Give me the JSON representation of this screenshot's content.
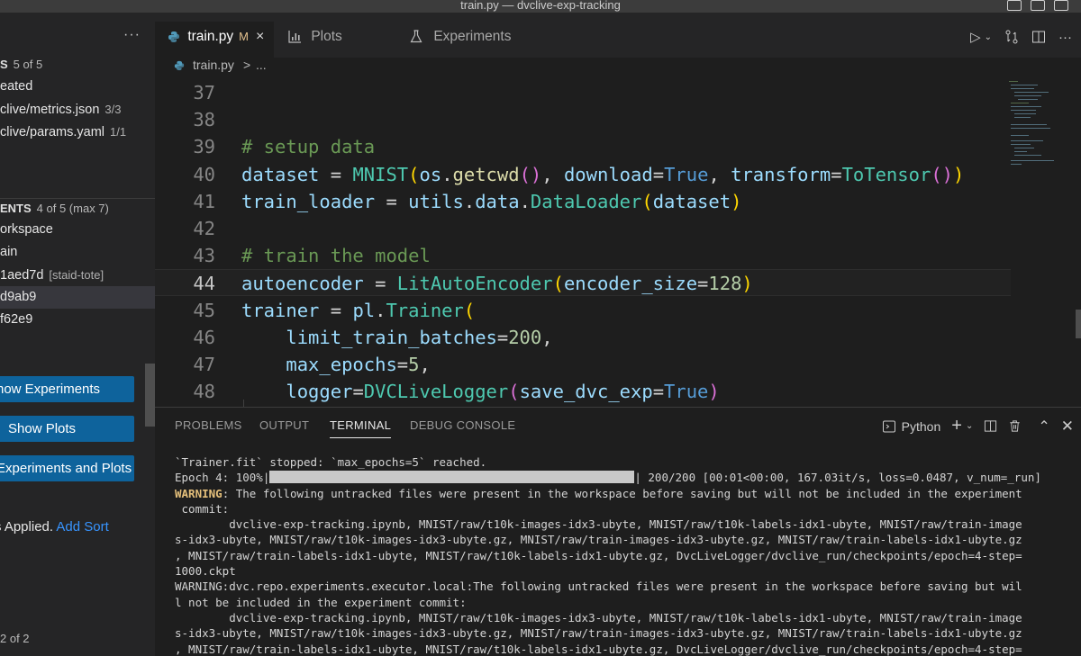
{
  "window": {
    "title": "train.py — dvclive-exp-tracking"
  },
  "sidebar": {
    "more": "···",
    "changes": {
      "header": "S",
      "count": "5 of 5",
      "items": [
        {
          "label": "eated",
          "meta": ""
        },
        {
          "label": "clive/metrics.json",
          "meta": "3/3"
        },
        {
          "label": "clive/params.yaml",
          "meta": "1/1"
        }
      ]
    },
    "experiments": {
      "header": "ENTS",
      "count": "4 of 5 (max 7)",
      "items": [
        {
          "label": "orkspace",
          "meta": ""
        },
        {
          "label": "ain",
          "meta": ""
        },
        {
          "label": "1aed7d",
          "meta": "[staid-tote]"
        },
        {
          "label": "d9ab9",
          "meta": ""
        },
        {
          "label": "f62e9",
          "meta": ""
        }
      ]
    },
    "buttons": {
      "show_experiments": "how Experiments",
      "show_plots": "Show Plots",
      "experiments_and_plots": "Experiments and Plots"
    },
    "sort": {
      "text": "s Applied.",
      "link": "Add Sort"
    },
    "pager": "2 of 2"
  },
  "tabs": [
    {
      "label": "train.py",
      "modified": "M",
      "close": "×"
    },
    {
      "label": "Plots"
    },
    {
      "label": "Experiments"
    }
  ],
  "breadcrumbs": {
    "file": "train.py",
    "sep": ">",
    "rest": "..."
  },
  "editor": {
    "lines": [
      {
        "n": "37",
        "code": [],
        "current": false
      },
      {
        "n": "38",
        "code": [],
        "current": false
      },
      {
        "n": "39",
        "code": [
          [
            "k-com",
            "# setup data"
          ]
        ],
        "current": false
      },
      {
        "n": "40",
        "code": [
          [
            "k-var",
            "dataset"
          ],
          [
            "k-op",
            " = "
          ],
          [
            "k-cls",
            "MNIST"
          ],
          [
            "k-br1",
            "("
          ],
          [
            "k-var",
            "os"
          ],
          [
            "k-op",
            "."
          ],
          [
            "k-fn",
            "getcwd"
          ],
          [
            "k-br2",
            "()"
          ],
          [
            "k-op",
            ", "
          ],
          [
            "k-var",
            "download"
          ],
          [
            "k-op",
            "="
          ],
          [
            "k-kw",
            "True"
          ],
          [
            "k-op",
            ", "
          ],
          [
            "k-var",
            "transform"
          ],
          [
            "k-op",
            "="
          ],
          [
            "k-cls",
            "ToTensor"
          ],
          [
            "k-br2",
            "()"
          ],
          [
            "k-br1",
            ")"
          ]
        ],
        "current": false
      },
      {
        "n": "41",
        "code": [
          [
            "k-var",
            "train_loader"
          ],
          [
            "k-op",
            " = "
          ],
          [
            "k-var",
            "utils"
          ],
          [
            "k-op",
            "."
          ],
          [
            "k-var",
            "data"
          ],
          [
            "k-op",
            "."
          ],
          [
            "k-cls",
            "DataLoader"
          ],
          [
            "k-br1",
            "("
          ],
          [
            "k-var",
            "dataset"
          ],
          [
            "k-br1",
            ")"
          ]
        ],
        "current": false
      },
      {
        "n": "42",
        "code": [],
        "current": false
      },
      {
        "n": "43",
        "code": [
          [
            "k-com",
            "# train the model"
          ]
        ],
        "current": false
      },
      {
        "n": "44",
        "code": [
          [
            "k-var",
            "autoencoder"
          ],
          [
            "k-op",
            " = "
          ],
          [
            "k-cls",
            "LitAutoEncoder"
          ],
          [
            "k-br1",
            "("
          ],
          [
            "k-var",
            "encoder_size"
          ],
          [
            "k-op",
            "="
          ],
          [
            "k-num",
            "128"
          ],
          [
            "k-br1",
            ")"
          ]
        ],
        "current": true
      },
      {
        "n": "45",
        "code": [
          [
            "k-var",
            "trainer"
          ],
          [
            "k-op",
            " = "
          ],
          [
            "k-var",
            "pl"
          ],
          [
            "k-op",
            "."
          ],
          [
            "k-cls",
            "Trainer"
          ],
          [
            "k-br1",
            "("
          ]
        ],
        "current": false
      },
      {
        "n": "46",
        "code": [
          [
            "k-op",
            "    "
          ],
          [
            "k-var",
            "limit_train_batches"
          ],
          [
            "k-op",
            "="
          ],
          [
            "k-num",
            "200"
          ],
          [
            "k-op",
            ","
          ]
        ],
        "current": false
      },
      {
        "n": "47",
        "code": [
          [
            "k-op",
            "    "
          ],
          [
            "k-var",
            "max_epochs"
          ],
          [
            "k-op",
            "="
          ],
          [
            "k-num",
            "5"
          ],
          [
            "k-op",
            ","
          ]
        ],
        "current": false
      },
      {
        "n": "48",
        "code": [
          [
            "k-op",
            "    "
          ],
          [
            "k-var",
            "logger"
          ],
          [
            "k-op",
            "="
          ],
          [
            "k-cls",
            "DVCLiveLogger"
          ],
          [
            "k-br2",
            "("
          ],
          [
            "k-var",
            "save_dvc_exp"
          ],
          [
            "k-op",
            "="
          ],
          [
            "k-kw",
            "True"
          ],
          [
            "k-br2",
            ")"
          ]
        ],
        "current": false
      }
    ]
  },
  "panel": {
    "tabs": [
      "PROBLEMS",
      "OUTPUT",
      "TERMINAL",
      "DEBUG CONSOLE"
    ],
    "active_tab": "TERMINAL",
    "shell": "Python",
    "terminal": {
      "line1": "`Trainer.fit` stopped: `max_epochs=5` reached.",
      "epoch_prefix": "Epoch 4: 100%|",
      "progress": 1.0,
      "epoch_suffix": "| 200/200 [00:01<00:00, 167.03it/s, loss=0.0487, v_num=_run]",
      "warn1_tag": "WARNING",
      "warn1_rest": ": The following untracked files were present in the workspace before saving but will not be included in the experiment",
      "warn1_cont": " commit:",
      "files1": [
        "        dvclive-exp-tracking.ipynb, MNIST/raw/t10k-images-idx3-ubyte, MNIST/raw/t10k-labels-idx1-ubyte, MNIST/raw/train-image",
        "s-idx3-ubyte, MNIST/raw/t10k-images-idx3-ubyte.gz, MNIST/raw/train-images-idx3-ubyte.gz, MNIST/raw/train-labels-idx1-ubyte.gz",
        ", MNIST/raw/train-labels-idx1-ubyte, MNIST/raw/t10k-labels-idx1-ubyte.gz, DvcLiveLogger/dvclive_run/checkpoints/epoch=4-step=",
        "1000.ckpt"
      ],
      "warn2": [
        "WARNING:dvc.repo.experiments.executor.local:The following untracked files were present in the workspace before saving but wil",
        "l not be included in the experiment commit:"
      ],
      "files2": [
        "        dvclive-exp-tracking.ipynb, MNIST/raw/t10k-images-idx3-ubyte, MNIST/raw/t10k-labels-idx1-ubyte, MNIST/raw/train-image",
        "s-idx3-ubyte, MNIST/raw/t10k-images-idx3-ubyte.gz, MNIST/raw/train-images-idx3-ubyte.gz, MNIST/raw/train-labels-idx1-ubyte.gz",
        ", MNIST/raw/train-labels-idx1-ubyte, MNIST/raw/t10k-labels-idx1-ubyte.gz, DvcLiveLogger/dvclive_run/checkpoints/epoch=4-step="
      ]
    }
  },
  "colors": {
    "button": "#0e639c",
    "link": "#3794ff",
    "warning": "#e5c07b"
  }
}
